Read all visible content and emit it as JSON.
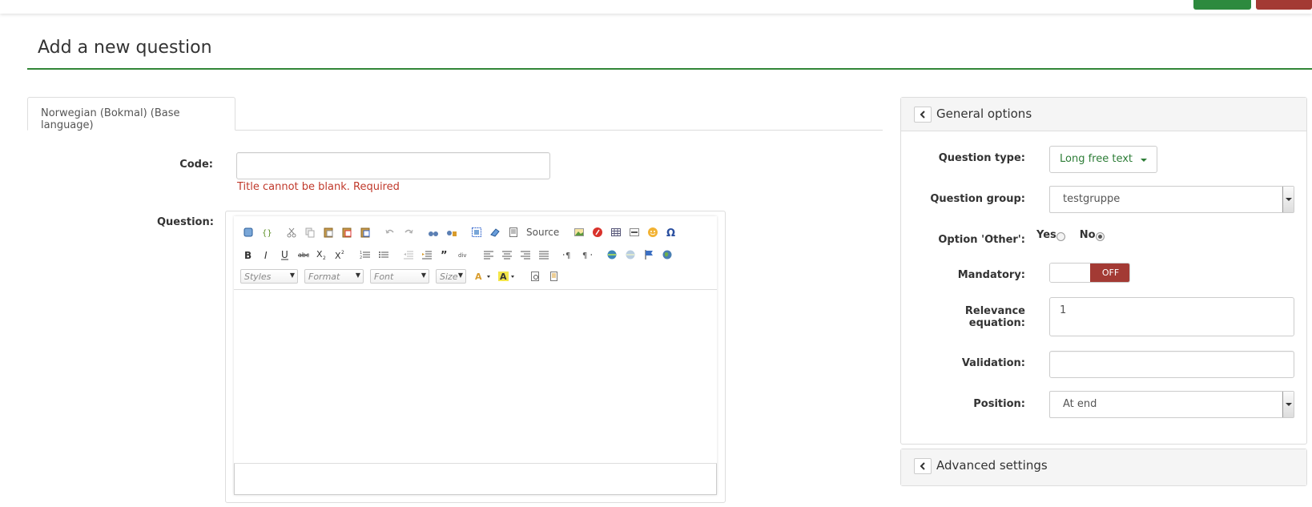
{
  "page": {
    "title": "Add a new question"
  },
  "tabs": [
    {
      "label": "Norwegian (Bokmal) (Base language)"
    }
  ],
  "form": {
    "code_label": "Code:",
    "code_value": "",
    "code_error": "Title cannot be blank. Required",
    "question_label": "Question:"
  },
  "editor": {
    "source_label": "Source",
    "combos": {
      "styles": "Styles",
      "format": "Format",
      "font": "Font",
      "size": "Size"
    }
  },
  "general_options": {
    "title": "General options",
    "question_type_label": "Question type:",
    "question_type_value": "Long free text",
    "question_group_label": "Question group:",
    "question_group_value": "testgruppe",
    "option_other_label": "Option 'Other':",
    "option_other_yes": "Yes",
    "option_other_no": "No",
    "option_other_selected": "No",
    "mandatory_label": "Mandatory:",
    "mandatory_state": "OFF",
    "relevance_label": "Relevance equation:",
    "relevance_value": "1",
    "validation_label": "Validation:",
    "validation_value": "",
    "position_label": "Position:",
    "position_value": "At end"
  },
  "advanced_settings": {
    "title": "Advanced settings"
  },
  "colors": {
    "accent_green": "#328637",
    "danger_red": "#a33a34",
    "error_text": "#c0392b"
  }
}
